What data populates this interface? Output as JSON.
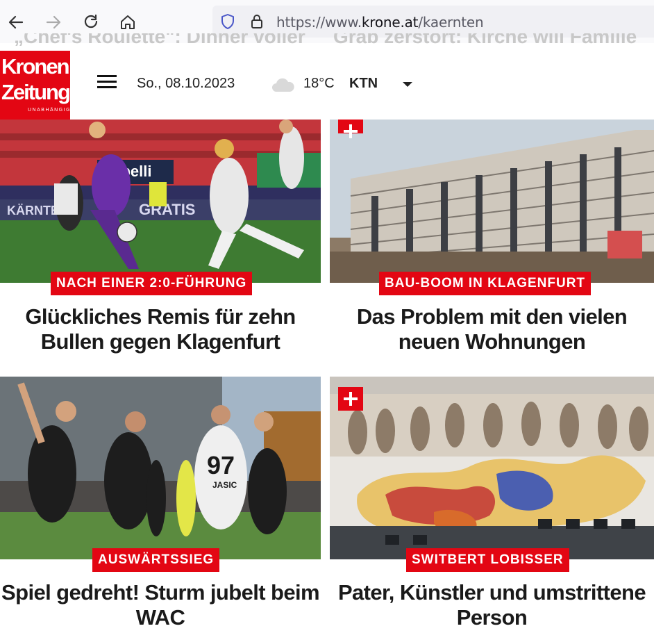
{
  "browser": {
    "back_icon": "arrow-left-icon",
    "forward_icon": "arrow-right-icon",
    "reload_icon": "reload-icon",
    "home_icon": "home-icon",
    "url_prefix": "https://www.",
    "url_domain": "krone.at",
    "url_path": "/kaernten"
  },
  "ghost_headlines": {
    "left": "„Chef's Roulette\": Dinner voller",
    "right": "Grab zerstört: Kirche will Familie"
  },
  "header": {
    "logo_line1": "Kronen",
    "logo_line2": "Zeitung",
    "logo_line3": "UNABHÄNGIG",
    "date": "So., 08.10.2023",
    "weather_icon": "cloud-icon",
    "temperature": "18°C",
    "region": "KTN"
  },
  "articles": [
    {
      "tag": "NACH EINER 2:0-FÜHRUNG",
      "headline": "Glückliches Remis für zehn Bullen gegen Klagenfurt",
      "plus": false
    },
    {
      "tag": "BAU-BOOM IN KLAGENFURT",
      "headline": "Das Problem mit den vielen neuen Wohnungen",
      "plus": true
    },
    {
      "tag": "AUSWÄRTSSIEG",
      "headline": "Spiel gedreht! Sturm jubelt beim WAC",
      "plus": false
    },
    {
      "tag": "SWITBERT LOBISSER",
      "headline": "Pater, Künstler und umstrittene Person",
      "plus": true
    }
  ],
  "photo_text": {
    "jersey_number": "97",
    "jersey_name": "JASIC",
    "ad_board": "capelli",
    "ad_board2": "GRATIS",
    "ad_board3": "KÄRNTEN"
  },
  "colors": {
    "brand_red": "#e30613",
    "toolbar_bg": "#f9f9fb",
    "urlbar_bg": "#f0f0f4"
  }
}
